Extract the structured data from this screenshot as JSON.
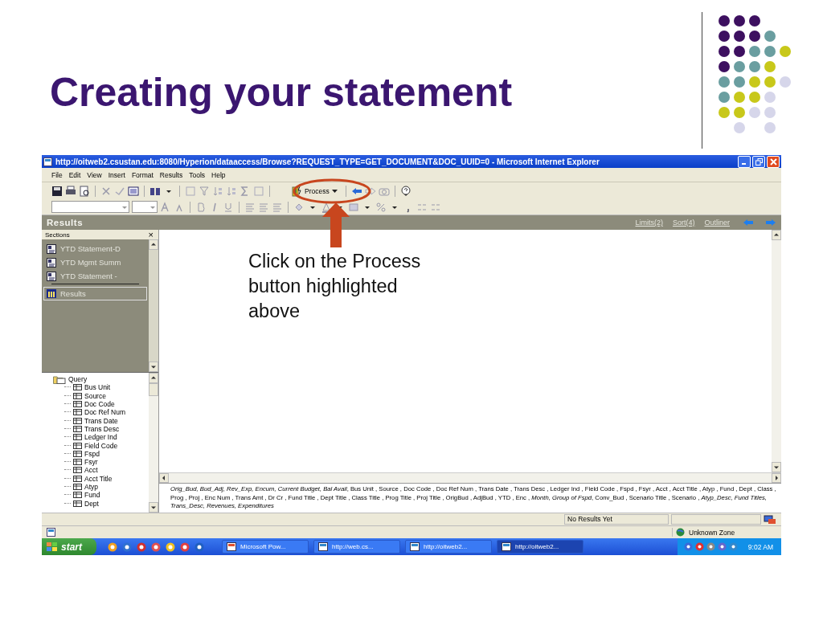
{
  "slide": {
    "title": "Creating your statement",
    "callout": "Click on the Process button highlighted above",
    "dot_rows": [
      [
        {
          "color": "#3d1060"
        },
        {
          "color": "#3d1060"
        },
        {
          "color": "#3d1060"
        },
        null,
        null
      ],
      [
        {
          "color": "#3d1060"
        },
        {
          "color": "#3d1060"
        },
        {
          "color": "#3d1060"
        },
        {
          "color": "#6a9ea0"
        },
        null
      ],
      [
        {
          "color": "#3d1060"
        },
        {
          "color": "#3d1060"
        },
        {
          "color": "#6a9ea0"
        },
        {
          "color": "#6a9ea0"
        },
        {
          "color": "#c8c81a"
        }
      ],
      [
        {
          "color": "#3d1060"
        },
        {
          "color": "#6a9ea0"
        },
        {
          "color": "#6a9ea0"
        },
        {
          "color": "#c8c81a"
        },
        null
      ],
      [
        {
          "color": "#6a9ea0"
        },
        {
          "color": "#6a9ea0"
        },
        {
          "color": "#c8c81a"
        },
        {
          "color": "#c8c81a"
        },
        {
          "color": "#d6d6ea"
        }
      ],
      [
        {
          "color": "#6a9ea0"
        },
        {
          "color": "#c8c81a"
        },
        {
          "color": "#c8c81a"
        },
        {
          "color": "#d6d6ea"
        },
        null
      ],
      [
        {
          "color": "#c8c81a"
        },
        {
          "color": "#c8c81a"
        },
        {
          "color": "#d6d6ea"
        },
        {
          "color": "#d6d6ea"
        },
        null
      ],
      [
        null,
        {
          "color": "#d6d6ea"
        },
        null,
        {
          "color": "#d6d6ea"
        },
        null
      ]
    ]
  },
  "window": {
    "title": "http://oitweb2.csustan.edu:8080/Hyperion/dataaccess/Browse?REQUEST_TYPE=GET_DOCUMENT&DOC_UUID=0 - Microsoft Internet Explorer"
  },
  "menu": [
    "File",
    "Edit",
    "View",
    "Insert",
    "Format",
    "Results",
    "Tools",
    "Help"
  ],
  "toolbar": {
    "process_button": "Process"
  },
  "results_bar": {
    "title": "Results",
    "links": [
      "Limits(2)",
      "Sort(4)",
      "Outliner"
    ]
  },
  "sections": {
    "heading": "Sections",
    "close": "×",
    "items": [
      {
        "label": "YTD Statement-D",
        "kind": "document",
        "selected": false
      },
      {
        "label": "YTD Mgmt Summ",
        "kind": "document",
        "selected": false
      },
      {
        "label": "YTD Statement -",
        "kind": "document",
        "selected": false
      },
      {
        "label": "Results",
        "kind": "table",
        "selected": true
      }
    ]
  },
  "tree": {
    "label": "Query",
    "children": [
      "Bus Unit",
      "Source",
      "Doc Code",
      "Doc Ref Num",
      "Trans Date",
      "Trans Desc",
      "Ledger Ind",
      "Field Code",
      "Fspd",
      "Fsyr",
      "Acct",
      "Acct Title",
      "Atyp",
      "Fund",
      "Dept"
    ]
  },
  "field_list": "*Orig_Bud, Bud_Adj, Rev_Exp, Encum, Current Budget, Bal Avail*, Bus Unit , Source , Doc Code , Doc Ref Num , Trans Date , Trans Desc , Ledger Ind , Field Code , Fspd , Fsyr , Acct , Acct Title , Atyp , Fund , Dept , Class , Prog , Proj , Enc Num , Trans Amt , Dr Cr , Fund Title , Dept Title , Class Title , Prog Title , Proj Title , OrigBud , AdjBud , YTD , Enc , *Month, Group of Fspd*, Conv_Bud , Scenario Title , Scenario , *Atyp_Desc, Fund Titles, Trans_Desc, Revenues, Expenditures*",
  "status_bar": {
    "message": "No Results Yet"
  },
  "ie_status": {
    "zone": "Unknown Zone"
  },
  "taskbar": {
    "start": "start",
    "tasks": [
      {
        "label": "Microsoft Pow...",
        "selected": false
      },
      {
        "label": "http://web.cs...",
        "selected": false
      },
      {
        "label": "http://oitweb2...",
        "selected": false
      },
      {
        "label": "http://oitweb2...",
        "selected": true
      }
    ],
    "clock": "9:02 AM"
  }
}
